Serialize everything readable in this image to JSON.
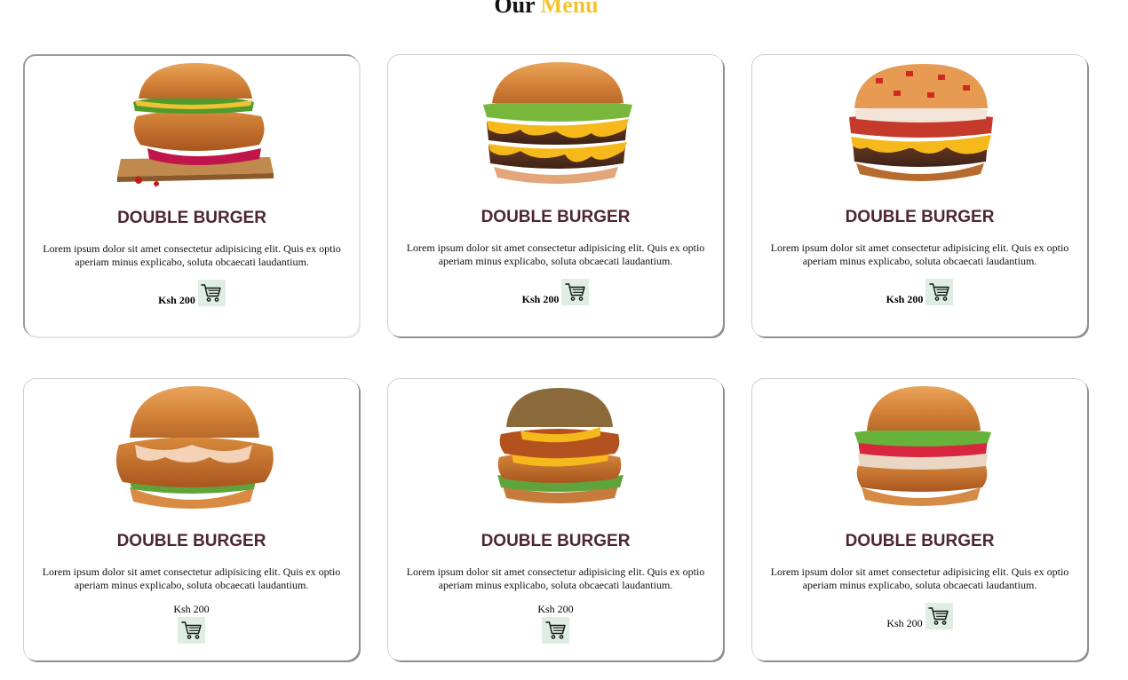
{
  "heading": {
    "word1": "Our",
    "word2": "Menu"
  },
  "colors": {
    "accent": "#f4c430",
    "title": "#4e2630",
    "cart_bg": "#deeee3"
  },
  "cards": [
    {
      "image": "crispy-chicken-burger-on-board",
      "title": "DOUBLE BURGER",
      "description": "Lorem ipsum dolor sit amet consectetur adipisicing elit. Quis ex optio aperiam minus explicabo, soluta obcaecati laudantium.",
      "price": "Ksh 200",
      "cart_icon": "cart-icon"
    },
    {
      "image": "double-cheese-burger",
      "title": "DOUBLE BURGER",
      "description": "Lorem ipsum dolor sit amet consectetur adipisicing elit. Quis ex optio aperiam minus explicabo, soluta obcaecati laudantium.",
      "price": "Ksh 200",
      "cart_icon": "cart-icon"
    },
    {
      "image": "bacon-tomato-cheese-burger",
      "title": "DOUBLE BURGER",
      "description": "Lorem ipsum dolor sit amet consectetur adipisicing elit. Quis ex optio aperiam minus explicabo, soluta obcaecati laudantium.",
      "price": "Ksh 200",
      "cart_icon": "cart-icon"
    },
    {
      "image": "fried-chicken-sauce-burger",
      "title": "DOUBLE BURGER",
      "description": "Lorem ipsum dolor sit amet consectetur adipisicing elit. Quis ex optio aperiam minus explicabo, soluta obcaecati laudantium.",
      "price": "Ksh 200",
      "cart_icon": "cart-icon"
    },
    {
      "image": "double-fried-chicken-burger",
      "title": "DOUBLE BURGER",
      "description": "Lorem ipsum dolor sit amet consectetur adipisicing elit. Quis ex optio aperiam minus explicabo, soluta obcaecati laudantium.",
      "price": "Ksh 200",
      "cart_icon": "cart-icon"
    },
    {
      "image": "chicken-bacon-salad-burger",
      "title": "DOUBLE BURGER",
      "description": "Lorem ipsum dolor sit amet consectetur adipisicing elit. Quis ex optio aperiam minus explicabo, soluta obcaecati laudantium.",
      "price": "Ksh 200",
      "cart_icon": "cart-icon"
    }
  ]
}
